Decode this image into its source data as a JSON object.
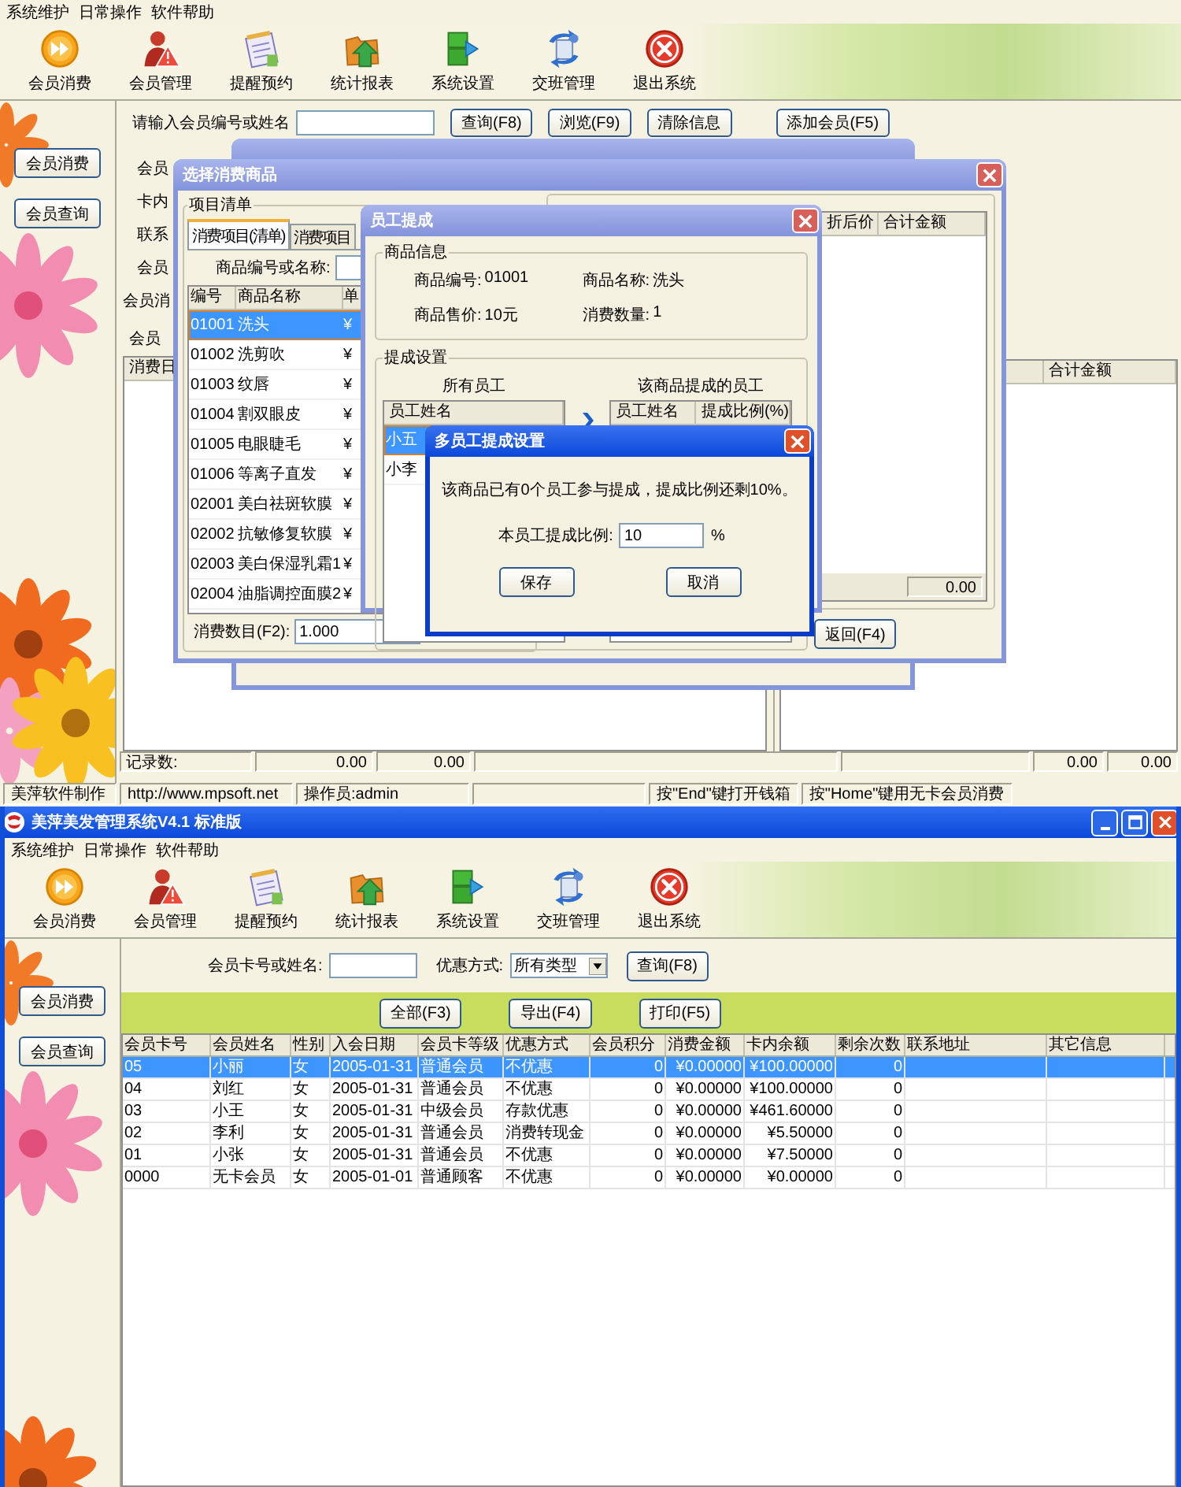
{
  "top_window": {
    "menu": [
      "系统维护",
      "日常操作",
      "软件帮助"
    ],
    "toolbar": [
      "会员消费",
      "会员管理",
      "提醒预约",
      "统计报表",
      "系统设置",
      "交班管理",
      "退出系统"
    ],
    "sidebar": [
      "会员消费",
      "会员查询"
    ],
    "search": {
      "label": "请输入会员编号或姓名",
      "buttons": [
        "查询(F8)",
        "浏览(F9)",
        "清除信息",
        "添加会员(F5)"
      ]
    },
    "form_labels": [
      "会员",
      "卡内",
      "联系",
      "会员"
    ],
    "tab_label": "会员消",
    "sub_label": "会员",
    "history_columns": [
      "消费日"
    ],
    "right_columns": [
      "合计金额"
    ],
    "totals": {
      "label": "记录数:",
      "left_values": [
        "0.00",
        "0.00"
      ],
      "right_values": [
        "0.00",
        "0.00"
      ]
    },
    "status_bar": [
      "美萍软件制作",
      "http://www.mpsoft.net",
      "操作员:admin",
      "按\"End\"键打开钱箱",
      "按\"Home\"键用无卡会员消费"
    ],
    "product_dialog": {
      "title": "选择消费商品",
      "group_label": "项目清单",
      "tabs": [
        {
          "label": "消费项目(清单)",
          "selected": true
        },
        {
          "label": "消费项目",
          "selected": false
        }
      ],
      "search_label": "商品编号或名称:",
      "columns": [
        "编号",
        "商品名称",
        "单"
      ],
      "rows": [
        {
          "code": "01001",
          "name": "洗头",
          "price": "¥",
          "selected": true
        },
        {
          "code": "01002",
          "name": "洗剪吹",
          "price": "¥",
          "selected": false
        },
        {
          "code": "01003",
          "name": "纹唇",
          "price": "¥",
          "selected": false
        },
        {
          "code": "01004",
          "name": "割双眼皮",
          "price": "¥",
          "selected": false
        },
        {
          "code": "01005",
          "name": "电眼睫毛",
          "price": "¥",
          "selected": false
        },
        {
          "code": "01006",
          "name": "等离子直发",
          "price": "¥",
          "selected": false
        },
        {
          "code": "02001",
          "name": "美白祛斑软膜",
          "price": "¥",
          "selected": false
        },
        {
          "code": "02002",
          "name": "抗敏修复软膜",
          "price": "¥",
          "selected": false
        },
        {
          "code": "02003",
          "name": "美白保湿乳霜1",
          "price": "¥",
          "selected": false
        },
        {
          "code": "02004",
          "name": "油脂调控面膜2",
          "price": "¥",
          "selected": false
        }
      ],
      "quantity_label": "消费数目(F2):",
      "quantity": "1.000",
      "selected_columns": [
        "折后价",
        "合计金额"
      ],
      "total": "0.00",
      "back_button": "返回(F4)"
    },
    "commission_dialog": {
      "title": "员工提成",
      "info_label": "商品信息",
      "info": [
        {
          "label": "商品编号:",
          "value": "01001"
        },
        {
          "label": "商品名称:",
          "value": "洗头"
        },
        {
          "label": "商品售价:",
          "value": "10元"
        },
        {
          "label": "消费数量:",
          "value": "1"
        }
      ],
      "settings_label": "提成设置",
      "all_staff_label": "所有员工",
      "staff_columns": [
        "员工姓名"
      ],
      "staff": [
        {
          "name": "小五",
          "selected": true
        },
        {
          "name": "小李",
          "selected": false
        }
      ],
      "assigned_label": "该商品提成的员工",
      "assigned_columns": [
        "员工姓名",
        "提成比例(%)"
      ]
    },
    "multi_dialog": {
      "title": "多员工提成设置",
      "message": "该商品已有0个员工参与提成，提成比例还剩10%。",
      "ratio_label": "本员工提成比例:",
      "ratio": "10",
      "unit": "%",
      "buttons": [
        "保存",
        "取消"
      ]
    }
  },
  "bottom_window": {
    "title": "美萍美发管理系统V4.1 标准版",
    "menu": [
      "系统维护",
      "日常操作",
      "软件帮助"
    ],
    "toolbar": [
      "会员消费",
      "会员管理",
      "提醒预约",
      "统计报表",
      "系统设置",
      "交班管理",
      "退出系统"
    ],
    "sidebar": [
      "会员消费",
      "会员查询"
    ],
    "filter": {
      "name_label": "会员卡号或姓名:",
      "discount_label": "优惠方式:",
      "discount_value": "所有类型",
      "query_button": "查询(F8)"
    },
    "actions": [
      "全部(F3)",
      "导出(F4)",
      "打印(F5)"
    ],
    "table": {
      "columns": [
        "会员卡号",
        "会员姓名",
        "性别",
        "入会日期",
        "会员卡等级",
        "优惠方式",
        "会员积分",
        "消费金额",
        "卡内余额",
        "剩余次数",
        "联系地址",
        "其它信息"
      ],
      "rows": [
        {
          "selected": true,
          "cells": [
            "05",
            "小丽",
            "女",
            "2005-01-31",
            "普通会员",
            "不优惠",
            "0",
            "¥0.00000",
            "¥100.00000",
            "0"
          ]
        },
        {
          "selected": false,
          "cells": [
            "04",
            "刘红",
            "女",
            "2005-01-31",
            "普通会员",
            "不优惠",
            "0",
            "¥0.00000",
            "¥100.00000",
            "0"
          ]
        },
        {
          "selected": false,
          "cells": [
            "03",
            "小王",
            "女",
            "2005-01-31",
            "中级会员",
            "存款优惠",
            "0",
            "¥0.00000",
            "¥461.60000",
            "0"
          ]
        },
        {
          "selected": false,
          "cells": [
            "02",
            "李利",
            "女",
            "2005-01-31",
            "普通会员",
            "消费转现金",
            "0",
            "¥0.00000",
            "¥5.50000",
            "0"
          ]
        },
        {
          "selected": false,
          "cells": [
            "01",
            "小张",
            "女",
            "2005-01-31",
            "普通会员",
            "不优惠",
            "0",
            "¥0.00000",
            "¥7.50000",
            "0"
          ]
        },
        {
          "selected": false,
          "cells": [
            "0000",
            "无卡会员",
            "女",
            "2005-01-01",
            "普通顾客",
            "不优惠",
            "0",
            "¥0.00000",
            "¥0.00000",
            "0"
          ]
        }
      ]
    }
  }
}
